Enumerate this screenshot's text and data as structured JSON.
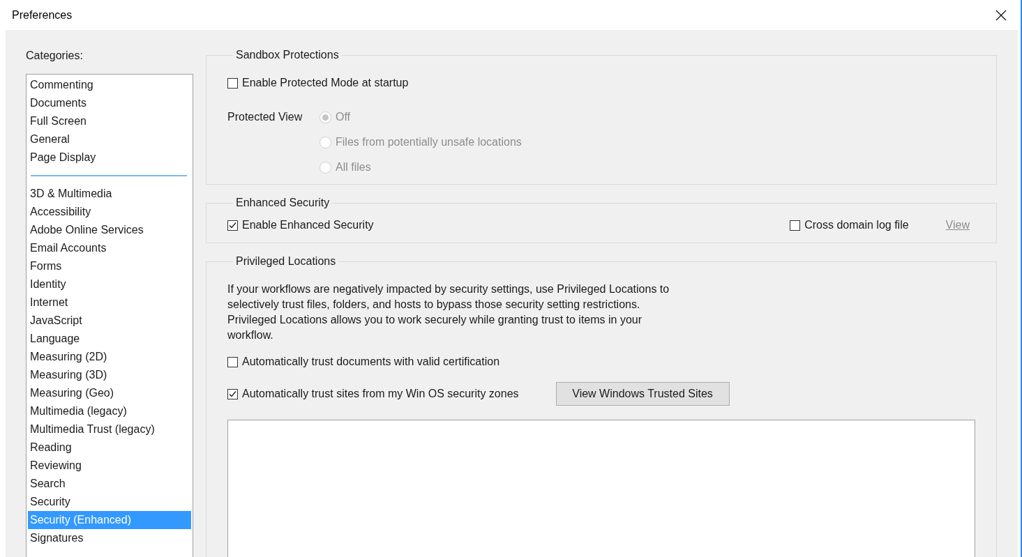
{
  "window": {
    "title": "Preferences"
  },
  "categories": {
    "label": "Categories:",
    "groups": [
      [
        {
          "label": "Commenting",
          "selected": false
        },
        {
          "label": "Documents",
          "selected": false
        },
        {
          "label": "Full Screen",
          "selected": false
        },
        {
          "label": "General",
          "selected": false
        },
        {
          "label": "Page Display",
          "selected": false
        }
      ],
      [
        {
          "label": "3D & Multimedia",
          "selected": false
        },
        {
          "label": "Accessibility",
          "selected": false
        },
        {
          "label": "Adobe Online Services",
          "selected": false
        },
        {
          "label": "Email Accounts",
          "selected": false
        },
        {
          "label": "Forms",
          "selected": false
        },
        {
          "label": "Identity",
          "selected": false
        },
        {
          "label": "Internet",
          "selected": false
        },
        {
          "label": "JavaScript",
          "selected": false
        },
        {
          "label": "Language",
          "selected": false
        },
        {
          "label": "Measuring (2D)",
          "selected": false
        },
        {
          "label": "Measuring (3D)",
          "selected": false
        },
        {
          "label": "Measuring (Geo)",
          "selected": false
        },
        {
          "label": "Multimedia (legacy)",
          "selected": false
        },
        {
          "label": "Multimedia Trust (legacy)",
          "selected": false
        },
        {
          "label": "Reading",
          "selected": false
        },
        {
          "label": "Reviewing",
          "selected": false
        },
        {
          "label": "Search",
          "selected": false
        },
        {
          "label": "Security",
          "selected": false
        },
        {
          "label": "Security (Enhanced)",
          "selected": true
        },
        {
          "label": "Signatures",
          "selected": false
        }
      ]
    ]
  },
  "sandbox_protections": {
    "title": "Sandbox Protections",
    "protected_mode": {
      "label": "Enable Protected Mode at startup",
      "checked": false
    },
    "protected_view": {
      "label": "Protected View",
      "disabled": true,
      "options": [
        {
          "label": "Off",
          "selected": true
        },
        {
          "label": "Files from potentially unsafe locations",
          "selected": false
        },
        {
          "label": "All files",
          "selected": false
        }
      ]
    }
  },
  "enhanced_security": {
    "title": "Enhanced Security",
    "enable": {
      "label": "Enable Enhanced Security",
      "checked": true
    },
    "cross_domain_log": {
      "label": "Cross domain log file",
      "checked": false
    },
    "view_link": {
      "label": "View",
      "disabled": true
    }
  },
  "privileged_locations": {
    "title": "Privileged Locations",
    "description": "If your workflows are negatively impacted by security settings, use Privileged Locations to selectively trust files, folders, and hosts to bypass those security setting restrictions. Privileged Locations allows you to work securely while granting trust to items in your workflow.",
    "trust_certified": {
      "label": "Automatically trust documents with valid certification",
      "checked": false
    },
    "trust_win_zones": {
      "label": "Automatically trust sites from my Win OS security zones",
      "checked": true
    },
    "button": "View Windows Trusted Sites"
  }
}
